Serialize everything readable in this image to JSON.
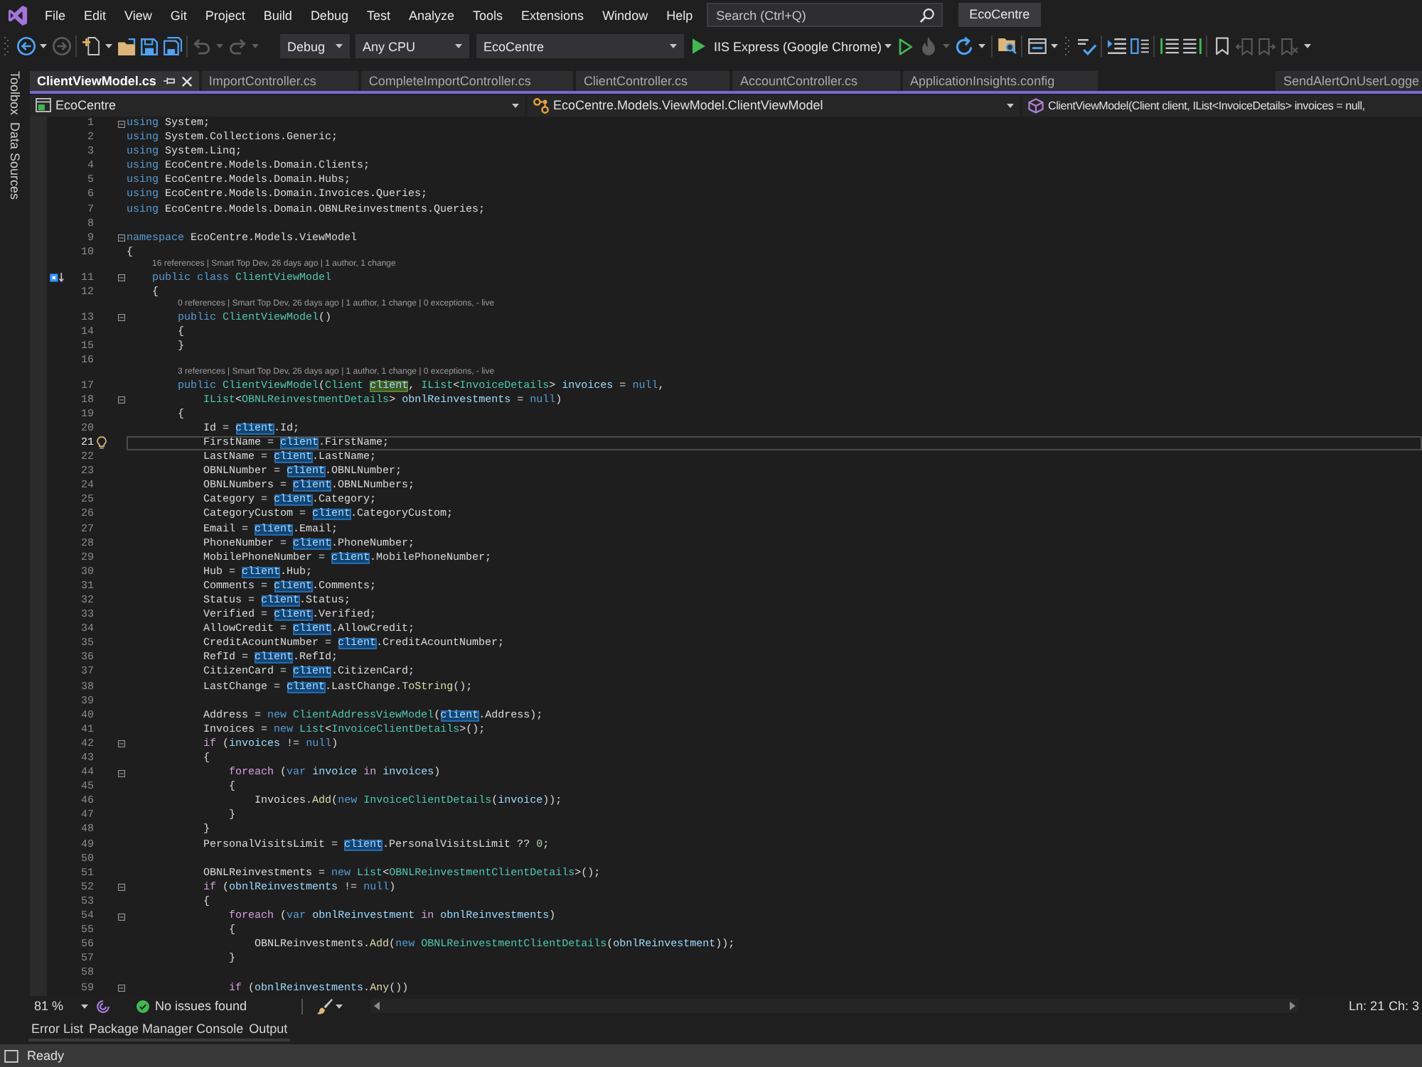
{
  "menu_bar": {
    "items": [
      "File",
      "Edit",
      "View",
      "Git",
      "Project",
      "Build",
      "Debug",
      "Test",
      "Analyze",
      "Tools",
      "Extensions",
      "Window",
      "Help"
    ],
    "search": {
      "placeholder": "Search (Ctrl+Q)"
    },
    "solution_name": "EcoCentre"
  },
  "toolbar": {
    "left_buttons": [
      {
        "kind": "grip"
      },
      {
        "kind": "back",
        "disabled": false
      },
      {
        "kind": "caret",
        "disabled": false
      },
      {
        "kind": "forward",
        "disabled": true
      },
      {
        "kind": "separator"
      },
      {
        "kind": "new",
        "disabled": false
      },
      {
        "kind": "caret",
        "disabled": false
      },
      {
        "kind": "open",
        "disabled": false
      },
      {
        "kind": "save",
        "disabled": false
      },
      {
        "kind": "save_all",
        "disabled": false
      },
      {
        "kind": "separator"
      },
      {
        "kind": "undo",
        "disabled": true
      },
      {
        "kind": "caret",
        "disabled": true
      },
      {
        "kind": "redo",
        "disabled": true
      },
      {
        "kind": "caret",
        "disabled": true
      }
    ],
    "configuration": "Debug",
    "platform": "Any CPU",
    "startup_project": "EcoCentre",
    "run_target": "IIS Express (Google Chrome)",
    "right_buttons": [
      {
        "kind": "run_outline",
        "disabled": false
      },
      {
        "kind": "hot_reload",
        "disabled": true
      },
      {
        "kind": "caret",
        "disabled": true
      },
      {
        "kind": "restart",
        "disabled": false
      },
      {
        "kind": "caret",
        "disabled": false
      },
      {
        "kind": "separator"
      },
      {
        "kind": "find_folder",
        "disabled": false
      },
      {
        "kind": "separator"
      },
      {
        "kind": "browser",
        "disabled": false
      },
      {
        "kind": "caret",
        "disabled": false
      },
      {
        "kind": "grip"
      },
      {
        "kind": "spell",
        "disabled": false
      },
      {
        "kind": "separator"
      },
      {
        "kind": "indent",
        "disabled": false
      },
      {
        "kind": "columns",
        "disabled": false
      },
      {
        "kind": "separator"
      },
      {
        "kind": "comment",
        "disabled": false
      },
      {
        "kind": "uncomment",
        "disabled": false
      },
      {
        "kind": "separator"
      },
      {
        "kind": "bookmark",
        "disabled": false
      },
      {
        "kind": "bookmark_prev",
        "disabled": true
      },
      {
        "kind": "bookmark_next",
        "disabled": true
      },
      {
        "kind": "bookmark_clear",
        "disabled": true
      },
      {
        "kind": "caret",
        "disabled": false
      }
    ]
  },
  "side_tabs": [
    "Toolbox",
    "Data Sources"
  ],
  "document_tabs": [
    {
      "label": "ClientViewModel.cs",
      "selected": true
    },
    {
      "label": "ImportController.cs",
      "selected": false
    },
    {
      "label": "CompleteImportController.cs",
      "selected": false
    },
    {
      "label": "ClientController.cs",
      "selected": false
    },
    {
      "label": "AccountController.cs",
      "selected": false
    },
    {
      "label": "ApplicationInsights.config",
      "selected": false
    },
    {
      "label": "SendAlertOnUserLogge",
      "selected": false
    }
  ],
  "navigation_bar": {
    "project": "EcoCentre",
    "type": "EcoCentre.Models.ViewModel.ClientViewModel",
    "member": "ClientViewModel(Client client, IList<InvoiceDetails> invoices = null,"
  },
  "editor": {
    "lines": [
      {
        "kind": "code",
        "number": "1",
        "fold": true,
        "current": false,
        "tokens": [
          {
            "kind": "keyword",
            "text": "using"
          },
          {
            "kind": "plain",
            "text": " System;"
          }
        ]
      },
      {
        "kind": "code",
        "number": "2",
        "fold": false,
        "current": false,
        "tokens": [
          {
            "kind": "keyword",
            "text": "using"
          },
          {
            "kind": "plain",
            "text": " System.Collections.Generic;"
          }
        ]
      },
      {
        "kind": "code",
        "number": "3",
        "fold": false,
        "current": false,
        "tokens": [
          {
            "kind": "keyword",
            "text": "using"
          },
          {
            "kind": "plain",
            "text": " System.Linq;"
          }
        ]
      },
      {
        "kind": "code",
        "number": "4",
        "fold": false,
        "current": false,
        "tokens": [
          {
            "kind": "keyword",
            "text": "using"
          },
          {
            "kind": "plain",
            "text": " EcoCentre.Models.Domain.Clients;"
          }
        ]
      },
      {
        "kind": "code",
        "number": "5",
        "fold": false,
        "current": false,
        "tokens": [
          {
            "kind": "keyword",
            "text": "using"
          },
          {
            "kind": "plain",
            "text": " EcoCentre.Models.Domain.Hubs;"
          }
        ]
      },
      {
        "kind": "code",
        "number": "6",
        "fold": false,
        "current": false,
        "tokens": [
          {
            "kind": "keyword",
            "text": "using"
          },
          {
            "kind": "plain",
            "text": " EcoCentre.Models.Domain.Invoices.Queries;"
          }
        ]
      },
      {
        "kind": "code",
        "number": "7",
        "fold": false,
        "current": false,
        "tokens": [
          {
            "kind": "keyword",
            "text": "using"
          },
          {
            "kind": "plain",
            "text": " EcoCentre.Models.Domain.OBNLReinvestments.Queries;"
          }
        ]
      },
      {
        "kind": "code",
        "number": "8",
        "fold": false,
        "current": false
      },
      {
        "kind": "code",
        "number": "9",
        "fold": true,
        "current": false,
        "tokens": [
          {
            "kind": "keyword",
            "text": "namespace"
          },
          {
            "kind": "plain",
            "text": " EcoCentre.Models.ViewModel"
          }
        ]
      },
      {
        "kind": "code",
        "number": "10",
        "fold": false,
        "current": false,
        "tokens": [
          {
            "kind": "plain",
            "text": "{"
          }
        ]
      },
      {
        "kind": "inheritance",
        "number": "11",
        "fold": true,
        "current": false,
        "codelens": "16 references | Smart Top Dev, 26 days ago | 1 author, 1 change",
        "tokens": [
          {
            "kind": "keyword",
            "text": "    public class "
          },
          {
            "kind": "type",
            "text": "ClientViewModel"
          }
        ]
      },
      {
        "kind": "code",
        "number": "12",
        "fold": false,
        "current": false,
        "tokens": [
          {
            "kind": "plain",
            "text": "    {"
          }
        ]
      },
      {
        "kind": "code",
        "number": "13",
        "fold": true,
        "current": false,
        "codelens": "0 references | Smart Top Dev, 26 days ago | 1 author, 1 change | 0 exceptions, - live",
        "tokens": [
          {
            "kind": "keyword",
            "text": "        public "
          },
          {
            "kind": "type",
            "text": "ClientViewModel"
          },
          {
            "kind": "plain",
            "text": "()"
          }
        ]
      },
      {
        "kind": "code",
        "number": "14",
        "fold": false,
        "current": false,
        "tokens": [
          {
            "kind": "plain",
            "text": "        {"
          }
        ]
      },
      {
        "kind": "code",
        "number": "15",
        "fold": false,
        "current": false,
        "tokens": [
          {
            "kind": "plain",
            "text": "        }"
          }
        ]
      },
      {
        "kind": "code",
        "number": "16",
        "fold": false,
        "current": false
      },
      {
        "kind": "code",
        "number": "17",
        "fold": false,
        "current": false,
        "codelens": "3 references | Smart Top Dev, 26 days ago | 1 author, 1 change | 0 exceptions, - live",
        "tokens": [
          {
            "kind": "keyword",
            "text": "        public "
          },
          {
            "kind": "type",
            "text": "ClientViewModel"
          },
          {
            "kind": "plain",
            "text": "("
          },
          {
            "kind": "type",
            "text": "Client "
          },
          {
            "kind": "definition",
            "text": "client"
          },
          {
            "kind": "plain",
            "text": ", "
          },
          {
            "kind": "type",
            "text": "IList"
          },
          {
            "kind": "plain",
            "text": "<"
          },
          {
            "kind": "type",
            "text": "InvoiceDetails"
          },
          {
            "kind": "plain",
            "text": "> "
          },
          {
            "kind": "variable",
            "text": "invoices"
          },
          {
            "kind": "plain",
            "text": " = "
          },
          {
            "kind": "keyword",
            "text": "null"
          },
          {
            "kind": "plain",
            "text": ","
          }
        ]
      },
      {
        "kind": "code",
        "number": "18",
        "fold": true,
        "current": false,
        "tokens": [
          {
            "kind": "type",
            "text": "            IList"
          },
          {
            "kind": "plain",
            "text": "<"
          },
          {
            "kind": "type",
            "text": "OBNLReinvestmentDetails"
          },
          {
            "kind": "plain",
            "text": "> "
          },
          {
            "kind": "variable",
            "text": "obnlReinvestments"
          },
          {
            "kind": "plain",
            "text": " = "
          },
          {
            "kind": "keyword",
            "text": "null"
          },
          {
            "kind": "plain",
            "text": ")"
          }
        ]
      },
      {
        "kind": "code",
        "number": "19",
        "fold": false,
        "current": false,
        "tokens": [
          {
            "kind": "plain",
            "text": "        {"
          }
        ]
      },
      {
        "kind": "code",
        "number": "20",
        "fold": false,
        "current": false,
        "tokens": [
          {
            "kind": "plain",
            "text": "            Id = "
          },
          {
            "kind": "reference",
            "text": "client"
          },
          {
            "kind": "plain",
            "text": ".Id;"
          }
        ]
      },
      {
        "kind": "code",
        "number": "21",
        "fold": false,
        "current": true,
        "tokens": [
          {
            "kind": "plain",
            "text": "            FirstName = "
          },
          {
            "kind": "reference",
            "text": "client"
          },
          {
            "kind": "plain",
            "text": ".FirstName;"
          }
        ]
      },
      {
        "kind": "code",
        "number": "22",
        "fold": false,
        "current": false,
        "tokens": [
          {
            "kind": "plain",
            "text": "            LastName = "
          },
          {
            "kind": "reference",
            "text": "client"
          },
          {
            "kind": "plain",
            "text": ".LastName;"
          }
        ]
      },
      {
        "kind": "code",
        "number": "23",
        "fold": false,
        "current": false,
        "tokens": [
          {
            "kind": "plain",
            "text": "            OBNLNumber = "
          },
          {
            "kind": "reference",
            "text": "client"
          },
          {
            "kind": "plain",
            "text": ".OBNLNumber;"
          }
        ]
      },
      {
        "kind": "code",
        "number": "24",
        "fold": false,
        "current": false,
        "tokens": [
          {
            "kind": "plain",
            "text": "            OBNLNumbers = "
          },
          {
            "kind": "reference",
            "text": "client"
          },
          {
            "kind": "plain",
            "text": ".OBNLNumbers;"
          }
        ]
      },
      {
        "kind": "code",
        "number": "25",
        "fold": false,
        "current": false,
        "tokens": [
          {
            "kind": "plain",
            "text": "            Category = "
          },
          {
            "kind": "reference",
            "text": "client"
          },
          {
            "kind": "plain",
            "text": ".Category;"
          }
        ]
      },
      {
        "kind": "code",
        "number": "26",
        "fold": false,
        "current": false,
        "tokens": [
          {
            "kind": "plain",
            "text": "            CategoryCustom = "
          },
          {
            "kind": "reference",
            "text": "client"
          },
          {
            "kind": "plain",
            "text": ".CategoryCustom;"
          }
        ]
      },
      {
        "kind": "code",
        "number": "27",
        "fold": false,
        "current": false,
        "tokens": [
          {
            "kind": "plain",
            "text": "            Email = "
          },
          {
            "kind": "reference",
            "text": "client"
          },
          {
            "kind": "plain",
            "text": ".Email;"
          }
        ]
      },
      {
        "kind": "code",
        "number": "28",
        "fold": false,
        "current": false,
        "tokens": [
          {
            "kind": "plain",
            "text": "            PhoneNumber = "
          },
          {
            "kind": "reference",
            "text": "client"
          },
          {
            "kind": "plain",
            "text": ".PhoneNumber;"
          }
        ]
      },
      {
        "kind": "code",
        "number": "29",
        "fold": false,
        "current": false,
        "tokens": [
          {
            "kind": "plain",
            "text": "            MobilePhoneNumber = "
          },
          {
            "kind": "reference",
            "text": "client"
          },
          {
            "kind": "plain",
            "text": ".MobilePhoneNumber;"
          }
        ]
      },
      {
        "kind": "code",
        "number": "30",
        "fold": false,
        "current": false,
        "tokens": [
          {
            "kind": "plain",
            "text": "            Hub = "
          },
          {
            "kind": "reference",
            "text": "client"
          },
          {
            "kind": "plain",
            "text": ".Hub;"
          }
        ]
      },
      {
        "kind": "code",
        "number": "31",
        "fold": false,
        "current": false,
        "tokens": [
          {
            "kind": "plain",
            "text": "            Comments = "
          },
          {
            "kind": "reference",
            "text": "client"
          },
          {
            "kind": "plain",
            "text": ".Comments;"
          }
        ]
      },
      {
        "kind": "code",
        "number": "32",
        "fold": false,
        "current": false,
        "tokens": [
          {
            "kind": "plain",
            "text": "            Status = "
          },
          {
            "kind": "reference",
            "text": "client"
          },
          {
            "kind": "plain",
            "text": ".Status;"
          }
        ]
      },
      {
        "kind": "code",
        "number": "33",
        "fold": false,
        "current": false,
        "tokens": [
          {
            "kind": "plain",
            "text": "            Verified = "
          },
          {
            "kind": "reference",
            "text": "client"
          },
          {
            "kind": "plain",
            "text": ".Verified;"
          }
        ]
      },
      {
        "kind": "code",
        "number": "34",
        "fold": false,
        "current": false,
        "tokens": [
          {
            "kind": "plain",
            "text": "            AllowCredit = "
          },
          {
            "kind": "reference",
            "text": "client"
          },
          {
            "kind": "plain",
            "text": ".AllowCredit;"
          }
        ]
      },
      {
        "kind": "code",
        "number": "35",
        "fold": false,
        "current": false,
        "tokens": [
          {
            "kind": "plain",
            "text": "            CreditAcountNumber = "
          },
          {
            "kind": "reference",
            "text": "client"
          },
          {
            "kind": "plain",
            "text": ".CreditAcountNumber;"
          }
        ]
      },
      {
        "kind": "code",
        "number": "36",
        "fold": false,
        "current": false,
        "tokens": [
          {
            "kind": "plain",
            "text": "            RefId = "
          },
          {
            "kind": "reference",
            "text": "client"
          },
          {
            "kind": "plain",
            "text": ".RefId;"
          }
        ]
      },
      {
        "kind": "code",
        "number": "37",
        "fold": false,
        "current": false,
        "tokens": [
          {
            "kind": "plain",
            "text": "            CitizenCard = "
          },
          {
            "kind": "reference",
            "text": "client"
          },
          {
            "kind": "plain",
            "text": ".CitizenCard;"
          }
        ]
      },
      {
        "kind": "code",
        "number": "38",
        "fold": false,
        "current": false,
        "tokens": [
          {
            "kind": "plain",
            "text": "            LastChange = "
          },
          {
            "kind": "reference",
            "text": "client"
          },
          {
            "kind": "plain",
            "text": ".LastChange."
          },
          {
            "kind": "method",
            "text": "ToString"
          },
          {
            "kind": "plain",
            "text": "();"
          }
        ]
      },
      {
        "kind": "code",
        "number": "39",
        "fold": false,
        "current": false
      },
      {
        "kind": "code",
        "number": "40",
        "fold": false,
        "current": false,
        "tokens": [
          {
            "kind": "plain",
            "text": "            Address = "
          },
          {
            "kind": "keyword",
            "text": "new "
          },
          {
            "kind": "type",
            "text": "ClientAddressViewModel"
          },
          {
            "kind": "plain",
            "text": "("
          },
          {
            "kind": "reference",
            "text": "client"
          },
          {
            "kind": "plain",
            "text": ".Address);"
          }
        ]
      },
      {
        "kind": "code",
        "number": "41",
        "fold": false,
        "current": false,
        "tokens": [
          {
            "kind": "plain",
            "text": "            Invoices = "
          },
          {
            "kind": "keyword",
            "text": "new "
          },
          {
            "kind": "type",
            "text": "List"
          },
          {
            "kind": "plain",
            "text": "<"
          },
          {
            "kind": "type",
            "text": "InvoiceClientDetails"
          },
          {
            "kind": "plain",
            "text": ">();"
          }
        ]
      },
      {
        "kind": "code",
        "number": "42",
        "fold": true,
        "current": false,
        "tokens": [
          {
            "kind": "control",
            "text": "            if"
          },
          {
            "kind": "plain",
            "text": " ("
          },
          {
            "kind": "variable",
            "text": "invoices"
          },
          {
            "kind": "plain",
            "text": " != "
          },
          {
            "kind": "keyword",
            "text": "null"
          },
          {
            "kind": "plain",
            "text": ")"
          }
        ]
      },
      {
        "kind": "code",
        "number": "43",
        "fold": false,
        "current": false,
        "tokens": [
          {
            "kind": "plain",
            "text": "            {"
          }
        ]
      },
      {
        "kind": "code",
        "number": "44",
        "fold": true,
        "current": false,
        "tokens": [
          {
            "kind": "control",
            "text": "                foreach"
          },
          {
            "kind": "plain",
            "text": " ("
          },
          {
            "kind": "keyword",
            "text": "var "
          },
          {
            "kind": "variable",
            "text": "invoice "
          },
          {
            "kind": "control",
            "text": "in "
          },
          {
            "kind": "variable",
            "text": "invoices"
          },
          {
            "kind": "plain",
            "text": ")"
          }
        ]
      },
      {
        "kind": "code",
        "number": "45",
        "fold": false,
        "current": false,
        "tokens": [
          {
            "kind": "plain",
            "text": "                {"
          }
        ]
      },
      {
        "kind": "code",
        "number": "46",
        "fold": false,
        "current": false,
        "tokens": [
          {
            "kind": "plain",
            "text": "                    Invoices."
          },
          {
            "kind": "method",
            "text": "Add"
          },
          {
            "kind": "plain",
            "text": "("
          },
          {
            "kind": "keyword",
            "text": "new "
          },
          {
            "kind": "type",
            "text": "InvoiceClientDetails"
          },
          {
            "kind": "plain",
            "text": "("
          },
          {
            "kind": "variable",
            "text": "invoice"
          },
          {
            "kind": "plain",
            "text": "));"
          }
        ]
      },
      {
        "kind": "code",
        "number": "47",
        "fold": false,
        "current": false,
        "tokens": [
          {
            "kind": "plain",
            "text": "                }"
          }
        ]
      },
      {
        "kind": "code",
        "number": "48",
        "fold": false,
        "current": false,
        "tokens": [
          {
            "kind": "plain",
            "text": "            }"
          }
        ]
      },
      {
        "kind": "code",
        "number": "49",
        "fold": false,
        "current": false,
        "tokens": [
          {
            "kind": "plain",
            "text": "            PersonalVisitsLimit = "
          },
          {
            "kind": "reference",
            "text": "client"
          },
          {
            "kind": "plain",
            "text": ".PersonalVisitsLimit ?? "
          },
          {
            "kind": "number",
            "text": "0"
          },
          {
            "kind": "plain",
            "text": ";"
          }
        ]
      },
      {
        "kind": "code",
        "number": "50",
        "fold": false,
        "current": false
      },
      {
        "kind": "code",
        "number": "51",
        "fold": false,
        "current": false,
        "tokens": [
          {
            "kind": "plain",
            "text": "            OBNLReinvestments = "
          },
          {
            "kind": "keyword",
            "text": "new "
          },
          {
            "kind": "type",
            "text": "List"
          },
          {
            "kind": "plain",
            "text": "<"
          },
          {
            "kind": "type",
            "text": "OBNLReinvestmentClientDetails"
          },
          {
            "kind": "plain",
            "text": ">();"
          }
        ]
      },
      {
        "kind": "code",
        "number": "52",
        "fold": true,
        "current": false,
        "tokens": [
          {
            "kind": "control",
            "text": "            if"
          },
          {
            "kind": "plain",
            "text": " ("
          },
          {
            "kind": "variable",
            "text": "obnlReinvestments"
          },
          {
            "kind": "plain",
            "text": " != "
          },
          {
            "kind": "keyword",
            "text": "null"
          },
          {
            "kind": "plain",
            "text": ")"
          }
        ]
      },
      {
        "kind": "code",
        "number": "53",
        "fold": false,
        "current": false,
        "tokens": [
          {
            "kind": "plain",
            "text": "            {"
          }
        ]
      },
      {
        "kind": "code",
        "number": "54",
        "fold": true,
        "current": false,
        "tokens": [
          {
            "kind": "control",
            "text": "                foreach"
          },
          {
            "kind": "plain",
            "text": " ("
          },
          {
            "kind": "keyword",
            "text": "var "
          },
          {
            "kind": "variable",
            "text": "obnlReinvestment "
          },
          {
            "kind": "control",
            "text": "in "
          },
          {
            "kind": "variable",
            "text": "obnlReinvestments"
          },
          {
            "kind": "plain",
            "text": ")"
          }
        ]
      },
      {
        "kind": "code",
        "number": "55",
        "fold": false,
        "current": false,
        "tokens": [
          {
            "kind": "plain",
            "text": "                {"
          }
        ]
      },
      {
        "kind": "code",
        "number": "56",
        "fold": false,
        "current": false,
        "tokens": [
          {
            "kind": "plain",
            "text": "                    OBNLReinvestments."
          },
          {
            "kind": "method",
            "text": "Add"
          },
          {
            "kind": "plain",
            "text": "("
          },
          {
            "kind": "keyword",
            "text": "new "
          },
          {
            "kind": "type",
            "text": "OBNLReinvestmentClientDetails"
          },
          {
            "kind": "plain",
            "text": "("
          },
          {
            "kind": "variable",
            "text": "obnlReinvestment"
          },
          {
            "kind": "plain",
            "text": "));"
          }
        ]
      },
      {
        "kind": "code",
        "number": "57",
        "fold": false,
        "current": false,
        "tokens": [
          {
            "kind": "plain",
            "text": "                }"
          }
        ]
      },
      {
        "kind": "code",
        "number": "58",
        "fold": false,
        "current": false
      },
      {
        "kind": "code",
        "number": "59",
        "fold": true,
        "current": false,
        "tokens": [
          {
            "kind": "control",
            "text": "                if"
          },
          {
            "kind": "plain",
            "text": " ("
          },
          {
            "kind": "variable",
            "text": "obnlReinvestments"
          },
          {
            "kind": "plain",
            "text": "."
          },
          {
            "kind": "method",
            "text": "Any"
          },
          {
            "kind": "plain",
            "text": "())"
          }
        ]
      }
    ]
  },
  "editor_status": {
    "zoom": "81 %",
    "issues": "No issues found",
    "line": "Ln: 21",
    "column": "Ch: 3"
  },
  "tool_tabs": [
    "Error List",
    "Package Manager Console",
    "Output"
  ],
  "status_bar": {
    "text": "Ready"
  }
}
